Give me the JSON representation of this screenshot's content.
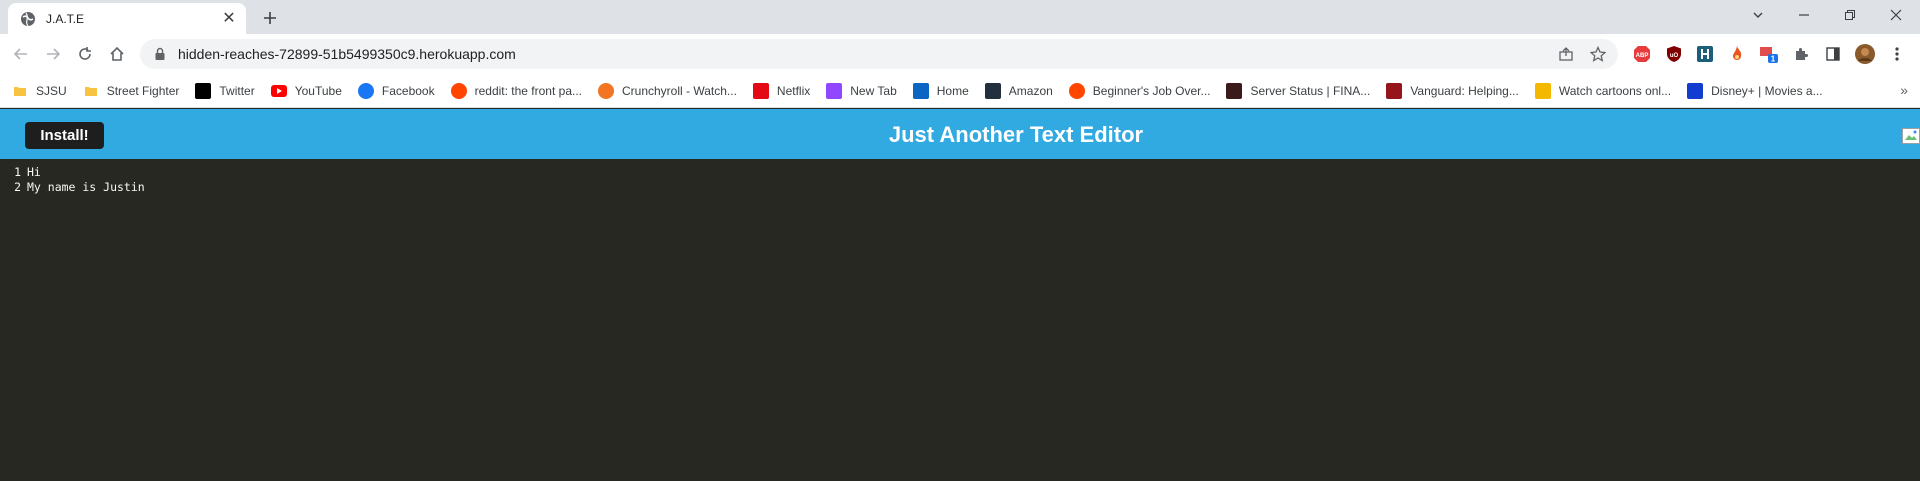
{
  "browser": {
    "tab": {
      "title": "J.A.T.E",
      "close_glyph": "✕",
      "favicon": "globe-icon"
    },
    "new_tab_glyph": "+",
    "address": {
      "url": "hidden-reaches-72899-51b5499350c9.herokuapp.com"
    },
    "window_controls": [
      "tab-search-icon",
      "minimize-icon",
      "restore-icon",
      "close-icon"
    ],
    "bookmarks": [
      {
        "label": "SJSU",
        "icon": "folder-icon",
        "color": "#f6c343"
      },
      {
        "label": "Street Fighter",
        "icon": "folder-icon",
        "color": "#f6c343"
      },
      {
        "label": "Twitter",
        "icon": "x-logo-icon",
        "color": "#000000"
      },
      {
        "label": "YouTube",
        "icon": "youtube-icon",
        "color": "#ff0000"
      },
      {
        "label": "Facebook",
        "icon": "facebook-icon",
        "color": "#1877f2"
      },
      {
        "label": "reddit: the front pa...",
        "icon": "reddit-icon",
        "color": "#ff4500"
      },
      {
        "label": "Crunchyroll - Watch...",
        "icon": "crunchyroll-icon",
        "color": "#f47521"
      },
      {
        "label": "Netflix",
        "icon": "netflix-icon",
        "color": "#e50914"
      },
      {
        "label": "New Tab",
        "icon": "twitch-icon",
        "color": "#9146ff"
      },
      {
        "label": "Home",
        "icon": "linkedin-icon",
        "color": "#0a66c2"
      },
      {
        "label": "Amazon",
        "icon": "amazon-icon",
        "color": "#232f3e"
      },
      {
        "label": "Beginner's Job Over...",
        "icon": "reddit-icon",
        "color": "#ff4500"
      },
      {
        "label": "Server Status | FINA...",
        "icon": "server-icon",
        "color": "#3a1a1a"
      },
      {
        "label": "Vanguard: Helping...",
        "icon": "vanguard-icon",
        "color": "#96151d"
      },
      {
        "label": "Watch cartoons onl...",
        "icon": "cartoon-icon",
        "color": "#f5b800"
      },
      {
        "label": "Disney+ | Movies a...",
        "icon": "disney-icon",
        "color": "#113ccf"
      }
    ],
    "bookmarks_overflow": "»"
  },
  "app": {
    "install_label": "Install!",
    "title": "Just Another Text Editor",
    "header_color": "#31a9e1",
    "editor_bg": "#272822",
    "lines": [
      {
        "num": "1",
        "text": "Hi"
      },
      {
        "num": "2",
        "text": "My name is Justin"
      }
    ]
  }
}
